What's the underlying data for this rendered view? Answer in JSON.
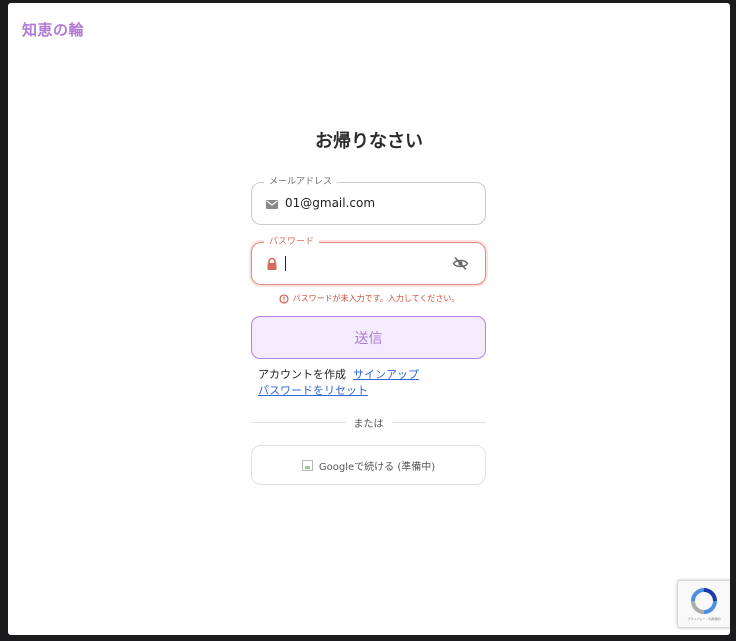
{
  "header": {
    "brand": "知恵の輪"
  },
  "login": {
    "heading": "お帰りなさい",
    "email": {
      "label": "メールアドレス",
      "value": "01@gmail.com",
      "icon": "envelope-icon"
    },
    "password": {
      "label": "パスワード",
      "value": "",
      "icon": "lock-icon",
      "toggle_icon": "eye-slash-icon"
    },
    "error_message": "パスワードが未入力です。入力してください。",
    "submit_label": "送信",
    "create_account_text": "アカウントを作成",
    "signup_link": "サインアップ",
    "reset_password_link": "パスワードをリセット",
    "divider_text": "または",
    "google_label": "Googleで続ける (準備中)"
  },
  "recaptcha": {
    "terms": "プライバシー - 利用規約"
  },
  "colors": {
    "brand": "#b07ad6",
    "error": "#cf4b3e",
    "link": "#3366d6",
    "submit_bg": "#f4ecfd"
  }
}
